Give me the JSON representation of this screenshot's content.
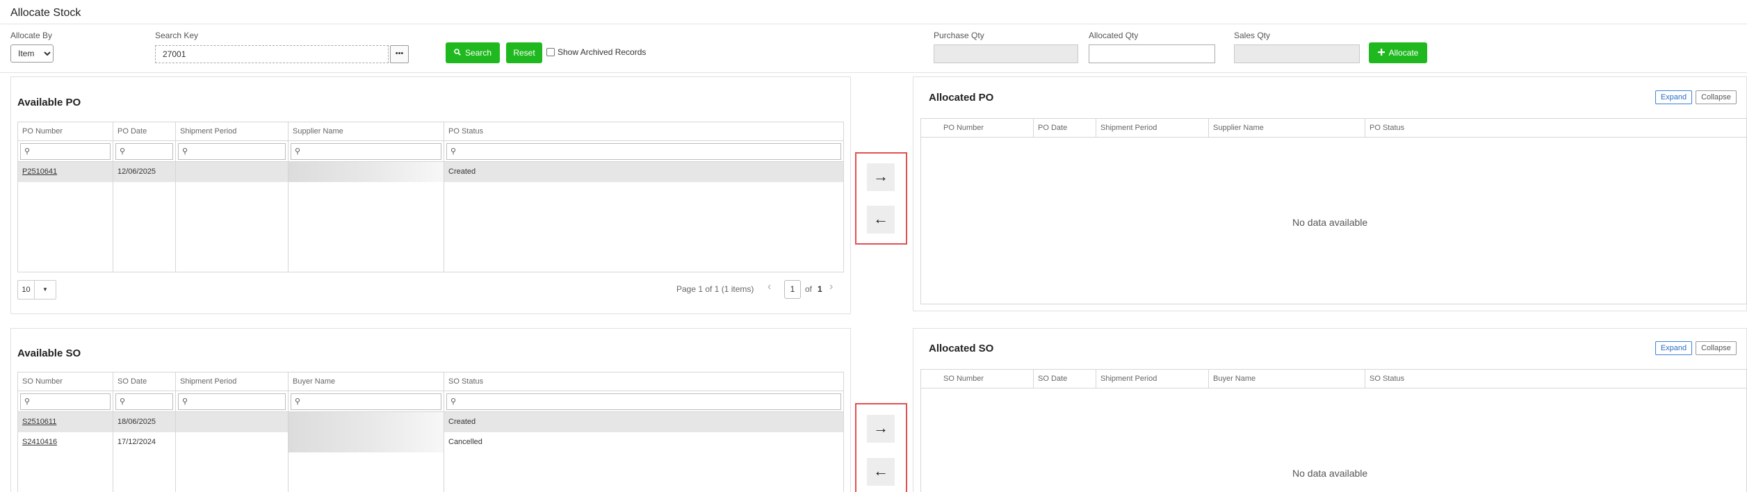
{
  "page": {
    "title": "Allocate Stock"
  },
  "filters": {
    "allocate_by_label": "Allocate By",
    "allocate_by_value": "Item",
    "search_key_label": "Search Key",
    "search_key_value": "27001",
    "ellipsis_label": "•••",
    "search_label": "Search",
    "reset_label": "Reset",
    "show_archived_label": "Show Archived Records",
    "purchase_qty_label": "Purchase Qty",
    "allocated_qty_label": "Allocated Qty",
    "sales_qty_label": "Sales Qty",
    "allocate_label": "Allocate"
  },
  "available_po": {
    "title": "Available PO",
    "columns": [
      "PO Number",
      "PO Date",
      "Shipment Period",
      "Supplier Name",
      "PO Status"
    ],
    "rows": [
      {
        "number": "P2510641",
        "date": "12/06/2025",
        "shipment": "",
        "party": "",
        "status": "Created"
      }
    ],
    "pager": {
      "page_size": "10",
      "info": "Page 1 of 1 (1 items)",
      "current": "1",
      "of": "of",
      "total": "1"
    }
  },
  "allocated_po": {
    "title": "Allocated PO",
    "expand_label": "Expand",
    "collapse_label": "Collapse",
    "columns": [
      "PO Number",
      "PO Date",
      "Shipment Period",
      "Supplier Name",
      "PO Status"
    ],
    "empty": "No data available"
  },
  "available_so": {
    "title": "Available SO",
    "columns": [
      "SO Number",
      "SO Date",
      "Shipment Period",
      "Buyer Name",
      "SO Status"
    ],
    "rows": [
      {
        "number": "S2510611",
        "date": "18/06/2025",
        "shipment": "",
        "party": "",
        "status": "Created"
      },
      {
        "number": "S2410416",
        "date": "17/12/2024",
        "shipment": "",
        "party": "",
        "status": "Cancelled"
      }
    ]
  },
  "allocated_so": {
    "title": "Allocated SO",
    "expand_label": "Expand",
    "collapse_label": "Collapse",
    "columns": [
      "SO Number",
      "SO Date",
      "Shipment Period",
      "Buyer Name",
      "SO Status"
    ],
    "empty": "No data available"
  },
  "move_buttons": {
    "right": "→",
    "left": "←"
  },
  "icons": {
    "search": "search-icon",
    "plus": "plus-icon",
    "dropdown": "caret-down-icon",
    "prev": "chevron-left-icon",
    "next": "chevron-right-icon"
  },
  "colors": {
    "accent_green": "#1fb91f",
    "highlight_border": "#e35050",
    "expand_blue": "#2a6fc2"
  }
}
